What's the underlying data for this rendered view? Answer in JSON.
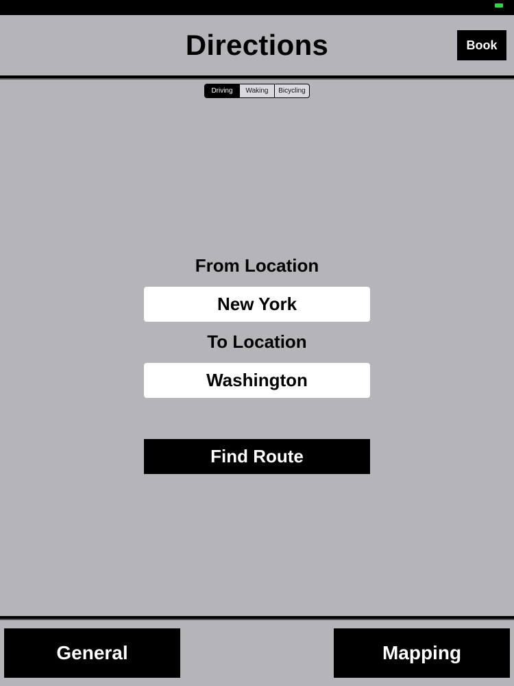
{
  "header": {
    "title": "Directions",
    "book_label": "Book"
  },
  "travel_mode": {
    "options": [
      "Driving",
      "Waking",
      "Bicycling"
    ],
    "selected": "Driving"
  },
  "form": {
    "from_label": "From Location",
    "from_value": "New York",
    "to_label": "To Location",
    "to_value": "Washington",
    "find_route_label": "Find Route"
  },
  "bottom_bar": {
    "general_label": "General",
    "mapping_label": "Mapping"
  },
  "colors": {
    "background": "#b5b4b8",
    "button": "#000000",
    "battery": "#35d24a"
  },
  "icons": {
    "battery": "battery-icon"
  }
}
